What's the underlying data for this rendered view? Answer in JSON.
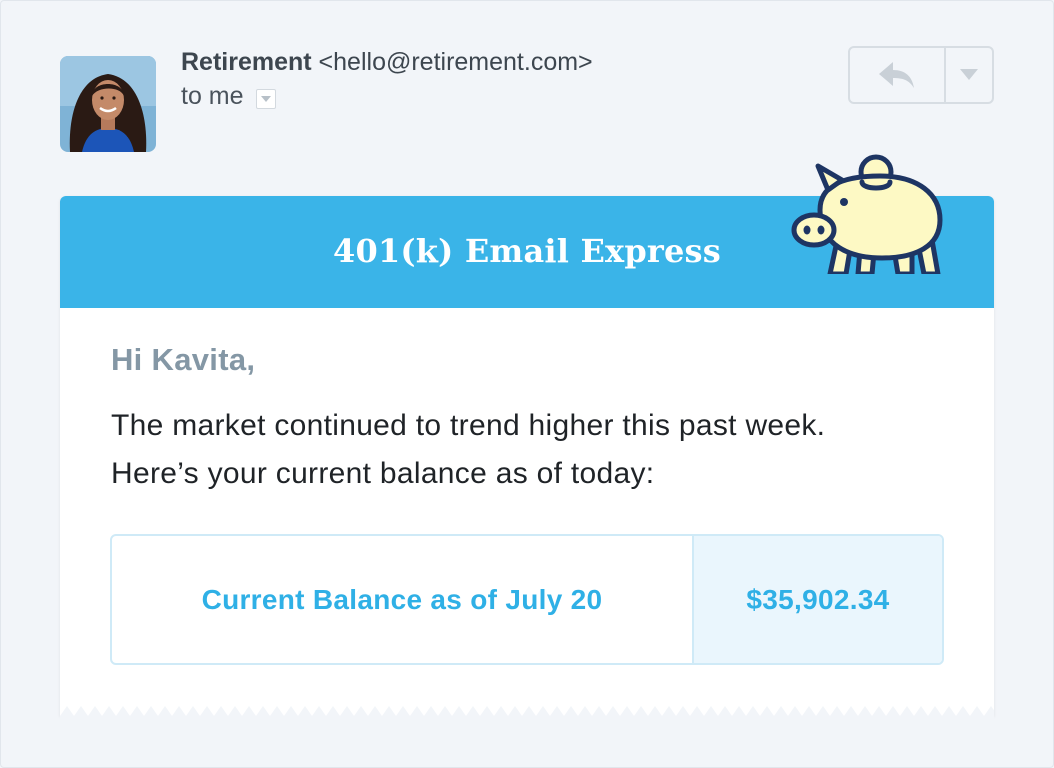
{
  "email_header": {
    "sender_name": "Retirement",
    "sender_email": "<hello@retirement.com>",
    "recipient": "to me"
  },
  "toolbar": {
    "reply_icon": "reply-icon",
    "more_icon": "chevron-down-icon"
  },
  "email_body": {
    "banner_title": "401(k) Email Express",
    "greeting": "Hi Kavita,",
    "message": "The market continued to trend higher this past week. Here’s your current balance as of today:",
    "balance_label": "Current Balance as of July 20",
    "balance_value": "$35,902.34"
  },
  "colors": {
    "banner": "#3ab4e8",
    "accent": "#2fb0e6",
    "pig_fill": "#fdf9c4",
    "pig_outline": "#1e3563"
  }
}
